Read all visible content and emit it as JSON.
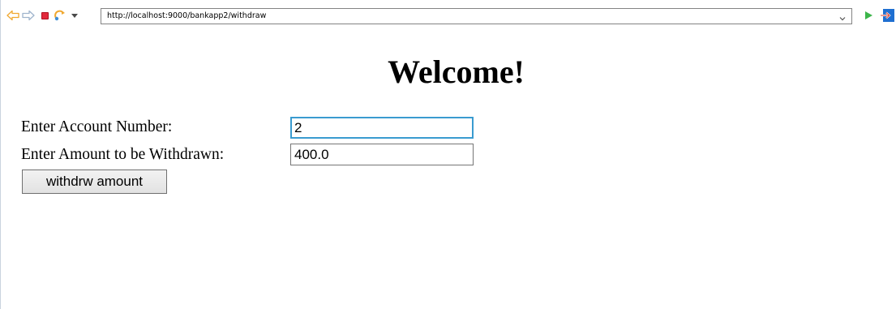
{
  "browser": {
    "address_url": "http://localhost:9000/bankapp2/withdraw",
    "icons": {
      "back": "back-arrow-icon",
      "forward": "forward-arrow-icon",
      "stop": "stop-icon",
      "refresh": "refresh-icon",
      "menu": "dropdown-caret-icon",
      "address_dropdown": "chevron-down-icon",
      "go": "go-arrow-icon",
      "exit": "exit-arrow-icon"
    },
    "colors": {
      "nav_arrow": "#f0a830",
      "stop": "#e2293c",
      "go": "#3cb54a",
      "exit": "#1f6fd1"
    }
  },
  "page": {
    "title": "Welcome!",
    "form": {
      "account_label": "Enter Account Number:",
      "account_value": "2",
      "amount_label": "Enter Amount to be Withdrawn:",
      "amount_value": "400.0",
      "submit_label": "withdrw amount"
    },
    "colors": {
      "focused_input_border": "#3a9bd0"
    }
  }
}
